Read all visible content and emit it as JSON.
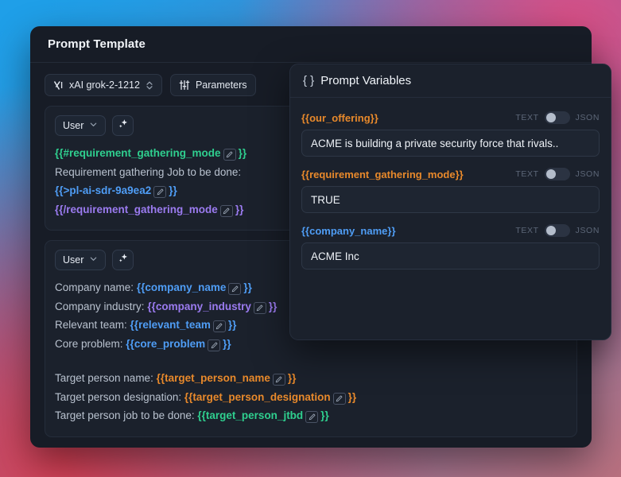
{
  "window": {
    "title": "Prompt Template"
  },
  "toolbar": {
    "model_label": "xAI grok-2-1212",
    "model_icon": "xai-logo-icon",
    "model_chevron_icon": "chevron-up-down-icon",
    "parameters_label": "Parameters",
    "parameters_icon": "sliders-icon"
  },
  "messages": [
    {
      "role_label": "User",
      "role_chevron_icon": "chevron-down-icon",
      "magic_icon": "sparkle-icon",
      "lines": [
        {
          "type": "var",
          "color": "green",
          "open": "{{#",
          "name": "requirement_gathering_mode",
          "close": "}}"
        },
        {
          "type": "text",
          "text": "Requirement gathering Job to be done:"
        },
        {
          "type": "var",
          "color": "blue",
          "open": "{{>",
          "name": "pl-ai-sdr-9a9ea2",
          "close": "}}"
        },
        {
          "type": "var",
          "color": "purple",
          "open": "{{/",
          "name": "requirement_gathering_mode",
          "close": "}}"
        }
      ]
    },
    {
      "role_label": "User",
      "role_chevron_icon": "chevron-down-icon",
      "magic_icon": "sparkle-icon",
      "lines": [
        {
          "type": "mixed",
          "label": "Company name: ",
          "color": "blue",
          "open": "{{",
          "name": "company_name",
          "close": "}}"
        },
        {
          "type": "mixed",
          "label": "Company industry: ",
          "color": "purple",
          "open": "{{",
          "name": "company_industry",
          "close": "}}"
        },
        {
          "type": "mixed",
          "label": "Relevant team: ",
          "color": "blue",
          "open": "{{",
          "name": "relevant_team",
          "close": "}}"
        },
        {
          "type": "mixed",
          "label": "Core problem: ",
          "color": "blue",
          "open": "{{",
          "name": "core_problem",
          "close": "}}"
        },
        {
          "type": "blank"
        },
        {
          "type": "mixed",
          "label": "Target person name: ",
          "color": "orange",
          "open": "{{",
          "name": "target_person_name",
          "close": "}}"
        },
        {
          "type": "mixed",
          "label": "Target person designation: ",
          "color": "orange",
          "open": "{{",
          "name": "target_person_designation",
          "close": "}}"
        },
        {
          "type": "mixed",
          "label": "Target person job to be done: ",
          "color": "green",
          "open": "{{",
          "name": "target_person_jtbd",
          "close": "}}"
        }
      ]
    }
  ],
  "variables_panel": {
    "braces_icon": "curly-braces-icon",
    "title": "Prompt Variables",
    "toggle_left_label": "TEXT",
    "toggle_right_label": "JSON",
    "rows": [
      {
        "key": "{{our_offering}}",
        "key_color": "#e8892b",
        "value": "ACME is building a private security force that rivals..",
        "mode": "TEXT"
      },
      {
        "key": "{{requirement_gathering_mode}}",
        "key_color": "#e8892b",
        "value": "TRUE",
        "mode": "TEXT"
      },
      {
        "key": "{{company_name}}",
        "key_color": "#4f9df5",
        "value": "ACME Inc",
        "mode": "TEXT"
      }
    ]
  },
  "colors": {
    "window_bg": "#171c26",
    "card_bg": "#1b212c",
    "green": "#2fcf8f",
    "blue": "#4f9df5",
    "purple": "#9b7bf0",
    "orange": "#e8892b"
  }
}
